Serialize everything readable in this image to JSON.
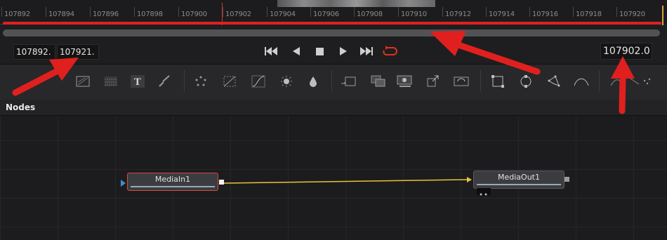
{
  "timeline": {
    "ticks": [
      "107892",
      "107894",
      "107896",
      "107898",
      "107900",
      "107902",
      "107904",
      "107906",
      "107908",
      "107910",
      "107912",
      "107914",
      "107916",
      "107918",
      "107920"
    ]
  },
  "transport": {
    "start_frame": "107892.",
    "end_frame": "107921.",
    "current_frame": "107902.0",
    "loop_color": "#e0301e"
  },
  "toolbar": {
    "tools": [
      "background-icon",
      "fast-noise-icon",
      "text-icon",
      "paint-icon",
      "particle-icon",
      "grid-warp-icon",
      "curves-icon",
      "brightness-icon",
      "color-corrector-icon",
      "transform-icon",
      "merge-icon",
      "media-in-icon",
      "resize-icon",
      "loop-icon",
      "rectangle-icon",
      "ellipse-icon",
      "polygon-icon",
      "bspline-icon",
      "more-tools-icon"
    ]
  },
  "panel": {
    "title": "Nodes"
  },
  "nodes": {
    "media_in": "MediaIn1",
    "media_out": "MediaOut1"
  },
  "colors": {
    "annotation_red": "#e0201e",
    "connection": "#e8c23a",
    "selected_border": "#d24a36"
  }
}
